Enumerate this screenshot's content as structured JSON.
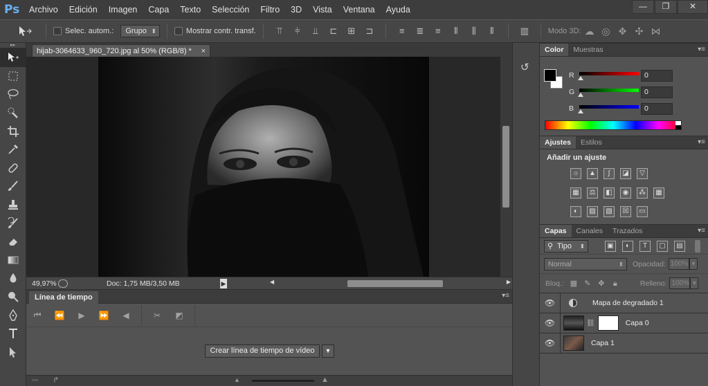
{
  "app": {
    "logo": "Ps"
  },
  "menu": [
    "Archivo",
    "Edición",
    "Imagen",
    "Capa",
    "Texto",
    "Selección",
    "Filtro",
    "3D",
    "Vista",
    "Ventana",
    "Ayuda"
  ],
  "window_controls": {
    "minimize": "—",
    "restore": "❐",
    "close": "✕"
  },
  "options": {
    "auto_select_label": "Selec. autom.:",
    "auto_select_mode": "Grupo",
    "show_transform_label": "Mostrar contr. transf.",
    "mode3d_label": "Modo 3D:"
  },
  "document": {
    "tab_title": "hijab-3064633_960_720.jpg al 50% (RGB/8) *",
    "tab_close": "×",
    "zoom": "49,97%",
    "doc_info": "Doc: 1,75 MB/3,50 MB"
  },
  "timeline": {
    "tab": "Línea de tiempo",
    "create_button": "Crear línea de tiempo de vídeo",
    "dropdown_arrow": "▼"
  },
  "color_panel": {
    "tabs": [
      "Color",
      "Muestras"
    ],
    "r_label": "R",
    "g_label": "G",
    "b_label": "B",
    "r_value": "0",
    "g_value": "0",
    "b_value": "0"
  },
  "adjust_panel": {
    "tabs": [
      "Ajustes",
      "Estilos"
    ],
    "title": "Añadir un ajuste"
  },
  "layers_panel": {
    "tabs": [
      "Capas",
      "Canales",
      "Trazados"
    ],
    "kind": "Tipo",
    "blend_mode": "Normal",
    "opacity_label": "Opacidad:",
    "opacity_value": "100%",
    "lock_label": "Bloq.:",
    "fill_label": "Relleno:",
    "fill_value": "100%",
    "layers": [
      {
        "name": "Mapa de degradado 1"
      },
      {
        "name": "Capa 0"
      },
      {
        "name": "Capa 1"
      }
    ]
  }
}
